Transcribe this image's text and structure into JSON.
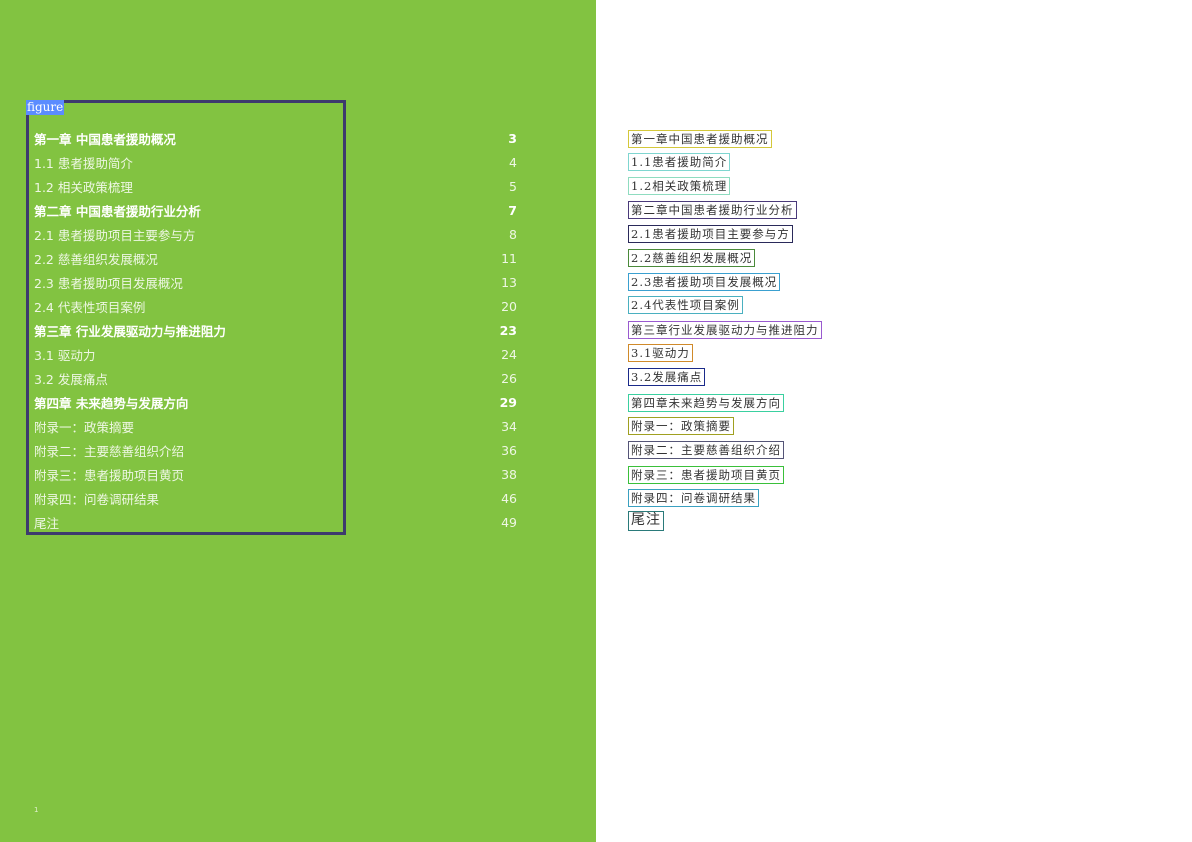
{
  "figure_label": "figure",
  "page_number": "1",
  "toc": [
    {
      "title": "第一章 中国患者援助概况",
      "page": "3",
      "bold": true
    },
    {
      "title": "1.1 患者援助简介",
      "page": "4"
    },
    {
      "title": "1.2 相关政策梳理",
      "page": "5"
    },
    {
      "title": "第二章 中国患者援助行业分析",
      "page": "7",
      "bold": true
    },
    {
      "title": "2.1 患者援助项目主要参与方",
      "page": "8"
    },
    {
      "title": "2.2 慈善组织发展概况",
      "page": "11"
    },
    {
      "title": "2.3 患者援助项目发展概况",
      "page": "13"
    },
    {
      "title": "2.4 代表性项目案例",
      "page": "20"
    },
    {
      "title": "第三章 行业发展驱动力与推进阻力",
      "page": "23",
      "bold": true
    },
    {
      "title": "3.1 驱动力",
      "page": "24"
    },
    {
      "title": "3.2 发展痛点",
      "page": "26"
    },
    {
      "title": "第四章 未来趋势与发展方向",
      "page": "29",
      "bold": true
    },
    {
      "title": "附录一：政策摘要",
      "page": "34"
    },
    {
      "title": "附录二：主要慈善组织介绍",
      "page": "36"
    },
    {
      "title": "附录三：患者援助项目黄页",
      "page": "38"
    },
    {
      "title": "附录四：问卷调研结果",
      "page": "46"
    },
    {
      "title": "尾注",
      "page": "49"
    }
  ],
  "ocr_items": [
    {
      "text": "第一章中国患者援助概况",
      "color": "#d4c83a"
    },
    {
      "text": "1.1患者援助简介",
      "color": "#7fd6d0"
    },
    {
      "text": "1.2相关政策梳理",
      "color": "#8fdcc0"
    },
    {
      "text": "第二章中国患者援助行业分析",
      "color": "#4a3a7a"
    },
    {
      "text": "2.1患者援助项目主要参与方",
      "color": "#2a2a5a"
    },
    {
      "text": "2.2慈善组织发展概况",
      "color": "#4a8a3a"
    },
    {
      "text": "2.3患者援助项目发展概况",
      "color": "#3aa0d0"
    },
    {
      "text": "2.4代表性项目案例",
      "color": "#4ab0c0"
    },
    {
      "text": "第三章行业发展驱动力与推进阻力",
      "color": "#9a5ad0"
    },
    {
      "text": "3.1驱动力",
      "color": "#d08a2a"
    },
    {
      "text": "3.2发展痛点",
      "color": "#1a2a8a"
    },
    {
      "text": "第四章未来趋势与发展方向",
      "color": "#3ad0a0"
    },
    {
      "text": "附录一：政策摘要",
      "color": "#a0a020"
    },
    {
      "text": "附录二：主要慈善组织介绍",
      "color": "#555577"
    },
    {
      "text": "附录三：患者援助项目黄页",
      "color": "#3ac03a"
    },
    {
      "text": "附录四：问卷调研结果",
      "color": "#3aa0c0"
    },
    {
      "text": "尾注",
      "color": "#2a7a7a"
    }
  ]
}
